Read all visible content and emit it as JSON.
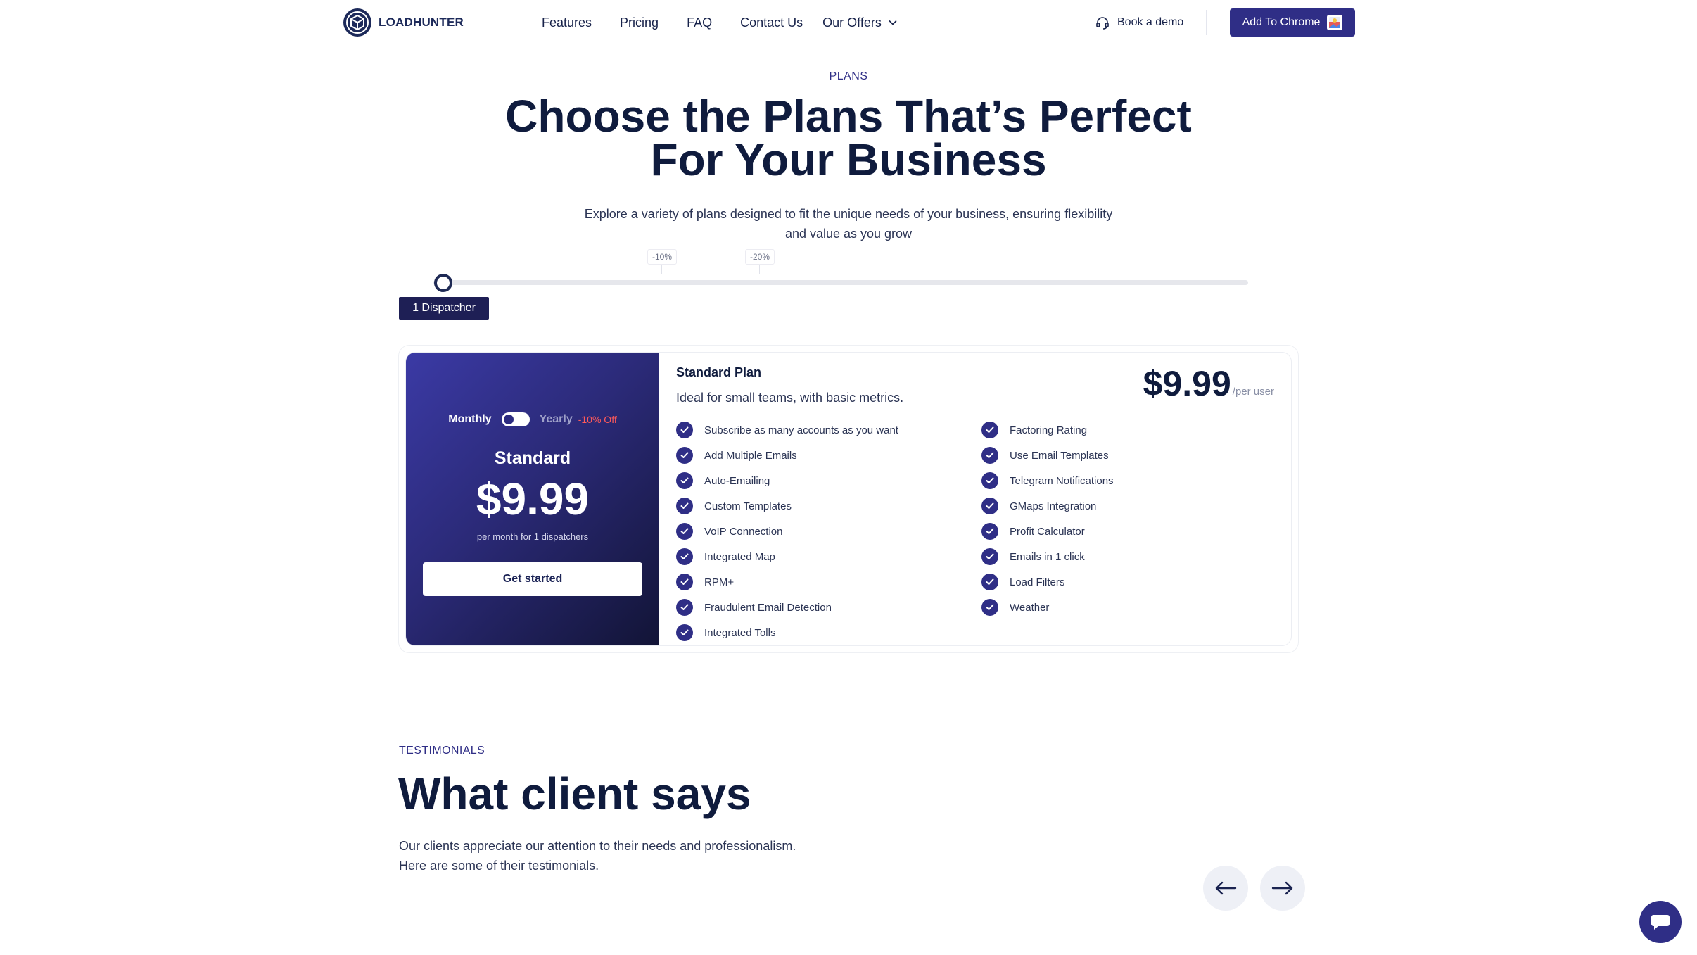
{
  "header": {
    "logo_text": "LOADHUNTER",
    "nav": [
      "Features",
      "Pricing",
      "FAQ",
      "Contact Us",
      "Our Offers"
    ],
    "book_demo": "Book a demo",
    "add_to_chrome": "Add To Chrome"
  },
  "hero": {
    "eyebrow": "PLANS",
    "title_line1": "Choose the Plans That’s Perfect",
    "title_line2": "For Your Business",
    "subtitle_line1": "Explore a variety of plans designed to fit the unique needs of your business, ensuring flexibility",
    "subtitle_line2": "and value as you grow"
  },
  "slider": {
    "tick1": "-10%",
    "tick2": "-20%",
    "value_label": "1 Dispatcher",
    "value": 1
  },
  "plan": {
    "toggle_monthly": "Monthly",
    "toggle_yearly": "Yearly",
    "yearly_discount": "-10% Off",
    "name": "Standard",
    "price": "$9.99",
    "per_text": "per month for 1 dispatchers",
    "cta": "Get started",
    "title": "Standard Plan",
    "description": "Ideal for small teams, with basic metrics.",
    "price_right": "$9.99",
    "price_unit": "/per user",
    "features_col1": [
      "Subscribe as many accounts as you want",
      "Add Multiple Emails",
      "Auto-Emailing",
      "Custom Templates",
      "VoIP Connection",
      "Integrated Map",
      "RPM+",
      "Fraudulent Email Detection",
      "Integrated Tolls"
    ],
    "features_col2": [
      "Factoring Rating",
      "Use Email Templates",
      "Telegram Notifications",
      "GMaps Integration",
      "Profit Calculator",
      "Emails in 1 click",
      "Load Filters",
      "Weather"
    ]
  },
  "testimonials": {
    "eyebrow": "TESTIMONIALS",
    "title": "What client says",
    "subtitle_line1": "Our clients appreciate our attention to their needs and professionalism.",
    "subtitle_line2": "Here are some of their testimonials."
  },
  "colors": {
    "brand": "#2f2e86",
    "heading": "#0f1b3d",
    "discount": "#ff5a5a"
  }
}
